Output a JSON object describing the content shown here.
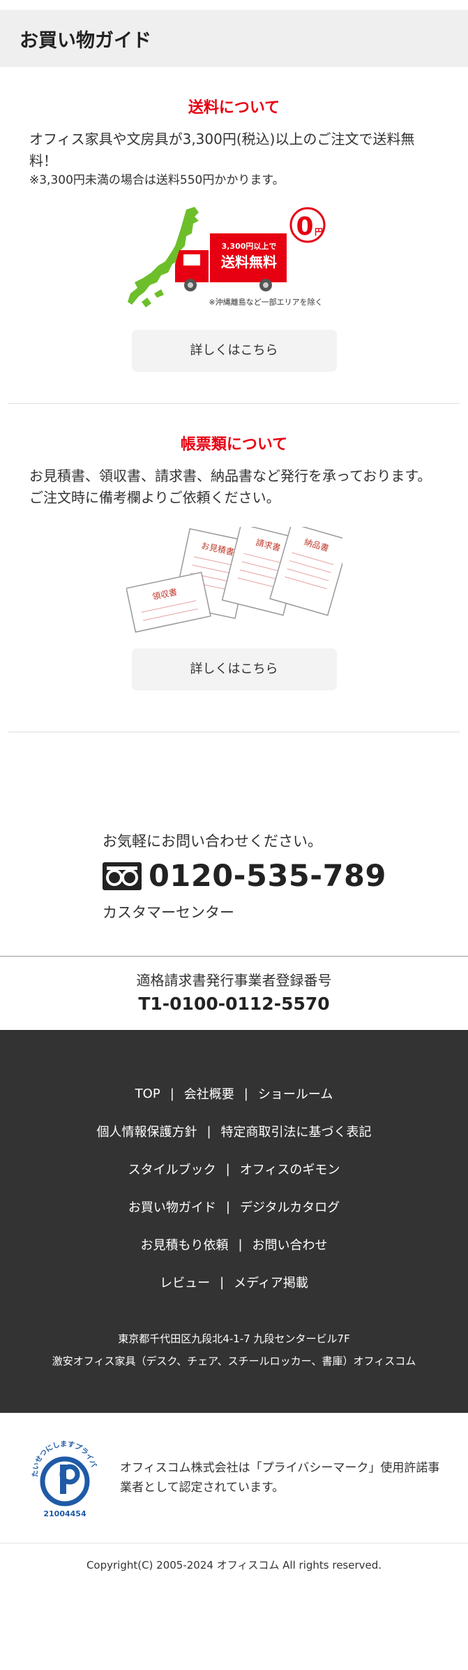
{
  "header": {
    "title": "お買い物ガイド"
  },
  "shipping": {
    "title": "送料について",
    "text": "オフィス家具や文房具が3,300円(税込)以上のご注文で送料無料！",
    "note": "※3,300円未満の場合は送料550円かかります。",
    "illust": {
      "badge_zero": "0",
      "badge_yen": "円",
      "truck_line1": "3,300円以上で",
      "truck_line2": "送料無料",
      "caption": "※沖縄離島など一部エリアを除く"
    },
    "button": "詳しくはこちら"
  },
  "documents": {
    "title": "帳票類について",
    "text": "お見積書、領収書、請求書、納品書など発行を承っております。ご注文時に備考欄よりご依頼ください。",
    "illust": {
      "doc1": "お見積書",
      "doc2": "請求書",
      "doc3": "納品書",
      "doc4": "領収書"
    },
    "button": "詳しくはこちら"
  },
  "contact": {
    "lead": "お気軽にお問い合わせください。",
    "phone": "0120-535-789",
    "sub": "カスタマーセンター"
  },
  "invoice": {
    "label": "適格請求書発行事業者登録番号",
    "number": "T1-0100-0112-5570"
  },
  "footer": {
    "rows": [
      [
        "TOP",
        "会社概要",
        "ショールーム"
      ],
      [
        "個人情報保護方針",
        "特定商取引法に基づく表記"
      ],
      [
        "スタイルブック",
        "オフィスのギモン"
      ],
      [
        "お買い物ガイド",
        "デジタルカタログ"
      ],
      [
        "お見積もり依頼",
        "お問い合わせ"
      ],
      [
        "レビュー",
        "メディア掲載"
      ]
    ],
    "address": "東京都千代田区九段北4-1-7 九段センタービル7F",
    "tagline": "激安オフィス家具（デスク、チェア、スチールロッカー、書庫）オフィスコム"
  },
  "privacy": {
    "mark_text": "たいせつにしますプライバシー",
    "mark_number": "21004454",
    "text": "オフィスコム株式会社は「プライバシーマーク」使用許諾事業者として認定されています。"
  },
  "copyright": "Copyright(C) 2005-2024 オフィスコム All rights reserved.",
  "colors": {
    "accent_red": "#e60012",
    "footer_bg": "#333333",
    "button_bg": "#f3f3f3",
    "privacy_blue": "#1f5aa6"
  }
}
